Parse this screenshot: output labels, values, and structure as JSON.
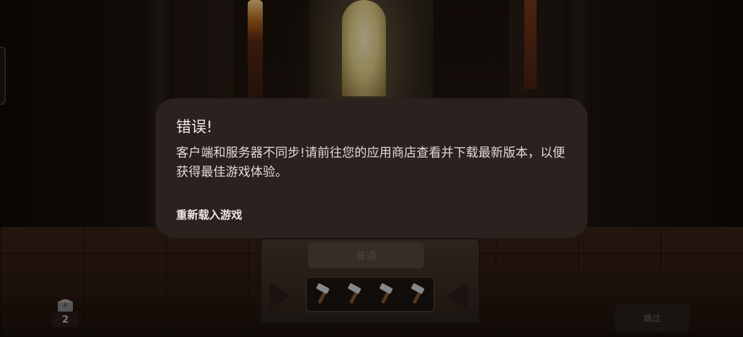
{
  "dialog": {
    "title": "错误!",
    "message": "客户端和服务器不同步!请前往您的应用商店查看并下载最新版本，以便获得最佳游戏体验。",
    "action_label": "重新载入游戏"
  },
  "pedestal": {
    "label": "普通",
    "hammer_count": 4
  },
  "chest": {
    "count": "2"
  },
  "skip": {
    "label": "跳过"
  },
  "colors": {
    "dialog_bg": "#2b2220",
    "dialog_text": "#ede5e2",
    "window_light": "#e9d68a"
  }
}
